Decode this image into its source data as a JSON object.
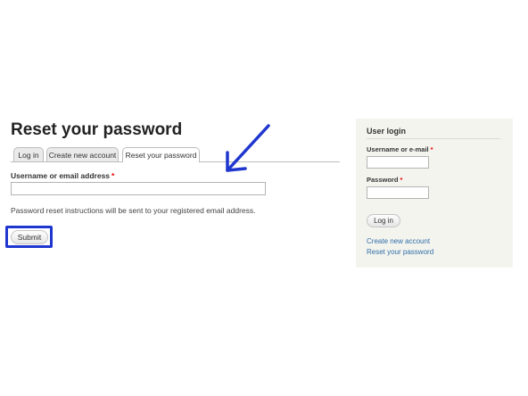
{
  "main": {
    "title": "Reset your password",
    "tabs": [
      {
        "label": "Log in"
      },
      {
        "label": "Create new account"
      },
      {
        "label": "Reset your password"
      }
    ],
    "field_label": "Username or email address",
    "required_mark": "*",
    "field_value": "",
    "description": "Password reset instructions will be sent to your registered email address.",
    "submit_label": "Submit"
  },
  "sidebar": {
    "title": "User login",
    "username_label": "Username or e-mail",
    "password_label": "Password",
    "required_mark": "*",
    "login_label": "Log in",
    "links": [
      {
        "label": "Create new account"
      },
      {
        "label": "Reset your password"
      }
    ]
  },
  "colors": {
    "annotation": "#1f37cf",
    "required": "#e00000",
    "link": "#2f6fa7",
    "sidebar_bg": "#f4f4ef"
  }
}
